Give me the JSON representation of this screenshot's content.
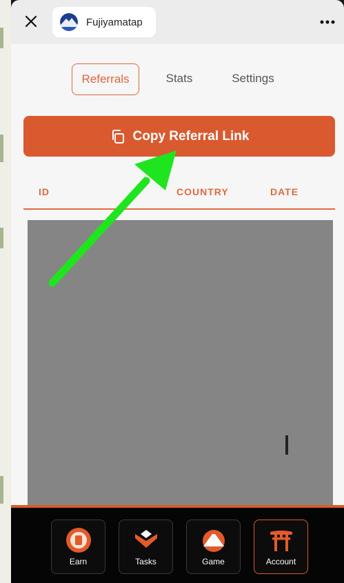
{
  "app": {
    "name": "Fujiyamatap"
  },
  "header": {
    "close_icon": "close-icon",
    "menu_icon": "more-icon"
  },
  "tabs": [
    {
      "label": "Referrals",
      "active": true
    },
    {
      "label": "Stats",
      "active": false
    },
    {
      "label": "Settings",
      "active": false
    }
  ],
  "copy_button": {
    "label": "Copy Referral Link",
    "icon": "copy-icon"
  },
  "table": {
    "columns": [
      "ID",
      "COUNTRY",
      "DATE"
    ]
  },
  "nav": [
    {
      "label": "Earn",
      "icon": "earn-coin-icon",
      "active": false
    },
    {
      "label": "Tasks",
      "icon": "tasks-icon",
      "active": false
    },
    {
      "label": "Game",
      "icon": "mountain-icon",
      "active": false
    },
    {
      "label": "Account",
      "icon": "torii-gate-icon",
      "active": true
    }
  ],
  "colors": {
    "accent": "#d95a2f",
    "annotation_arrow": "#1ee51e",
    "header_bg": "#ececec",
    "nav_bg": "#050505"
  }
}
